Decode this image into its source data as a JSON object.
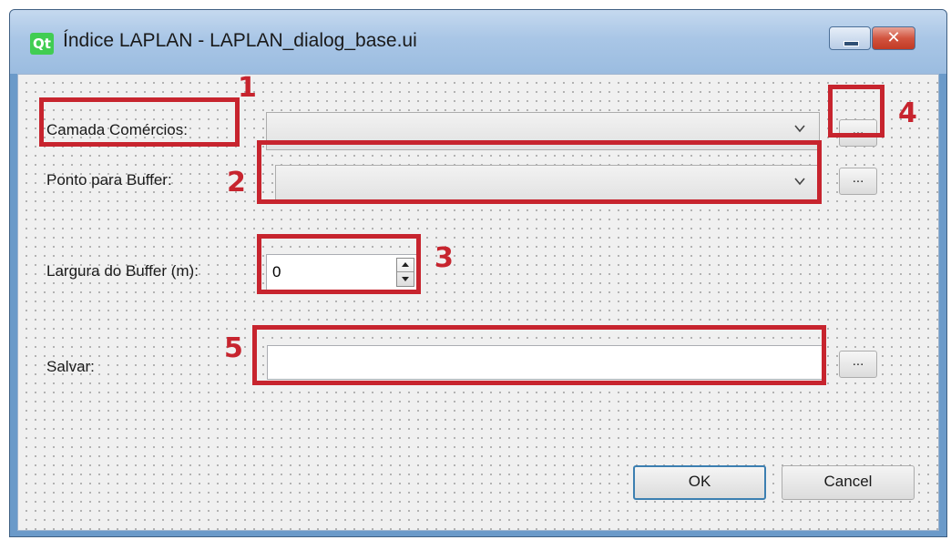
{
  "window": {
    "icon": "qt-logo-icon",
    "logo_text": "Qt",
    "title": "Índice LAPLAN - LAPLAN_dialog_base.ui",
    "close_glyph": "✕"
  },
  "form": {
    "camada_label": "Camada Comércios:",
    "camada_value": "",
    "ponto_label": "Ponto para Buffer:",
    "ponto_value": "",
    "largura_label": "Largura do Buffer (m):",
    "largura_value": "0",
    "salvar_label": "Salvar:",
    "salvar_value": "",
    "browse_label": "..."
  },
  "buttons": {
    "ok": "OK",
    "cancel": "Cancel"
  },
  "annotations": {
    "color": "#c7242e",
    "numbers": [
      "1",
      "2",
      "3",
      "4",
      "5"
    ]
  },
  "colors": {
    "title_bar": "#a9c6e6",
    "client_bg": "#f0f0f0",
    "default_button_border": "#3c7fb1",
    "close_button": "#c13a24"
  }
}
